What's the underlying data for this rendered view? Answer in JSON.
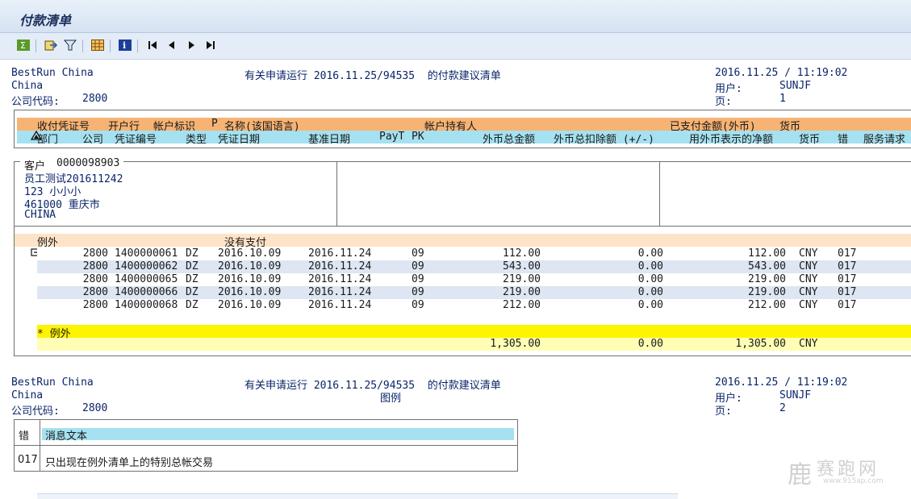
{
  "window": {
    "title": "付款清单"
  },
  "toolbar": {
    "icons": [
      "sum-icon",
      "export-icon",
      "filter-icon",
      "layout-grid-icon",
      "info-icon",
      "first-page-icon",
      "prev-page-icon",
      "next-page-icon",
      "last-page-icon"
    ]
  },
  "header1": {
    "company": "BestRun China",
    "country": "China",
    "company_code_label": "公司代码:",
    "company_code": "2800",
    "center": "有关申请运行 2016.11.25/94535  的付款建议清单",
    "datetime": "2016.11.25 / 11:19:02",
    "user_label": "用户:",
    "user": "SUNJF",
    "page_label": "页:",
    "page": "1"
  },
  "columns": {
    "row1": [
      "收付凭证号",
      "开户行",
      "帐户标识",
      "P",
      "名称(该国语言)",
      "帐户持有人",
      "已支付金额(外币)",
      "货币"
    ],
    "row2": [
      "部门",
      "公司",
      "凭证编号",
      "类型",
      "凭证日期",
      "基准日期",
      "PayT",
      "PK",
      "外币总金额",
      "外币总扣除额 (+/-)",
      "用外币表示的净额",
      "货币",
      "错",
      "服务请求"
    ]
  },
  "customer": {
    "label": "客户",
    "id": "0000098903",
    "name": "员工测试201611242",
    "street": "123 小小小",
    "city": "461000 重庆市",
    "country": "CHINA"
  },
  "exceptions": {
    "label": "例外",
    "status": "没有支付",
    "rows": [
      {
        "company": "2800",
        "doc": "1400000061",
        "type": "DZ",
        "doc_date": "2016.10.09",
        "base_date": "2016.11.24",
        "pk": "09",
        "gross": "112.00",
        "deduct": "0.00",
        "net": "112.00",
        "cur": "CNY",
        "err": "017"
      },
      {
        "company": "2800",
        "doc": "1400000062",
        "type": "DZ",
        "doc_date": "2016.10.09",
        "base_date": "2016.11.24",
        "pk": "09",
        "gross": "543.00",
        "deduct": "0.00",
        "net": "543.00",
        "cur": "CNY",
        "err": "017"
      },
      {
        "company": "2800",
        "doc": "1400000065",
        "type": "DZ",
        "doc_date": "2016.10.09",
        "base_date": "2016.11.24",
        "pk": "09",
        "gross": "219.00",
        "deduct": "0.00",
        "net": "219.00",
        "cur": "CNY",
        "err": "017"
      },
      {
        "company": "2800",
        "doc": "1400000066",
        "type": "DZ",
        "doc_date": "2016.10.09",
        "base_date": "2016.11.24",
        "pk": "09",
        "gross": "219.00",
        "deduct": "0.00",
        "net": "219.00",
        "cur": "CNY",
        "err": "017"
      },
      {
        "company": "2800",
        "doc": "1400000068",
        "type": "DZ",
        "doc_date": "2016.10.09",
        "base_date": "2016.11.24",
        "pk": "09",
        "gross": "212.00",
        "deduct": "0.00",
        "net": "212.00",
        "cur": "CNY",
        "err": "017"
      }
    ],
    "total_label": "* 例外",
    "total_gross": "1,305.00",
    "total_deduct": "0.00",
    "total_net": "1,305.00",
    "total_cur": "CNY"
  },
  "header2": {
    "company": "BestRun China",
    "country": "China",
    "company_code_label": "公司代码:",
    "company_code": "2800",
    "center": "有关申请运行 2016.11.25/94535  的付款建议清单",
    "center2": "图例",
    "datetime": "2016.11.25 / 11:19:02",
    "user_label": "用户:",
    "user": "SUNJF",
    "page_label": "页:",
    "page": "2"
  },
  "legend": {
    "col_err": "错",
    "col_text": "消息文本",
    "code": "017",
    "text": "只出现在例外清单上的特别总帐交易"
  },
  "watermark": {
    "text": "赛跑网",
    "sub": "www.915ap.com"
  }
}
